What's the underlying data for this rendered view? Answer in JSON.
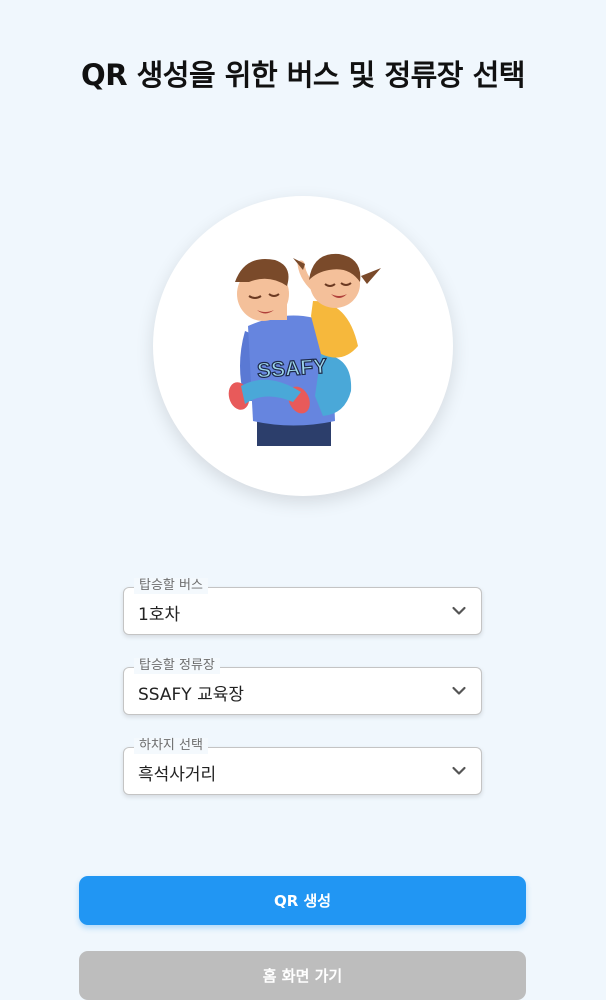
{
  "page": {
    "title": "QR 생성을 위한 버스 및 정류장 선택"
  },
  "illustration": {
    "shirt_text": "SSAFY"
  },
  "form": {
    "bus": {
      "label": "탑승할 버스",
      "value": "1호차"
    },
    "stop": {
      "label": "탑승할 정류장",
      "value": "SSAFY 교육장"
    },
    "dropoff": {
      "label": "하차지 선택",
      "value": "흑석사거리"
    }
  },
  "buttons": {
    "generate_label": "QR 생성",
    "home_label": "홈 화면 가기"
  },
  "colors": {
    "background": "#f0f7fd",
    "primary": "#2196f3",
    "secondary": "#bdbdbd"
  }
}
